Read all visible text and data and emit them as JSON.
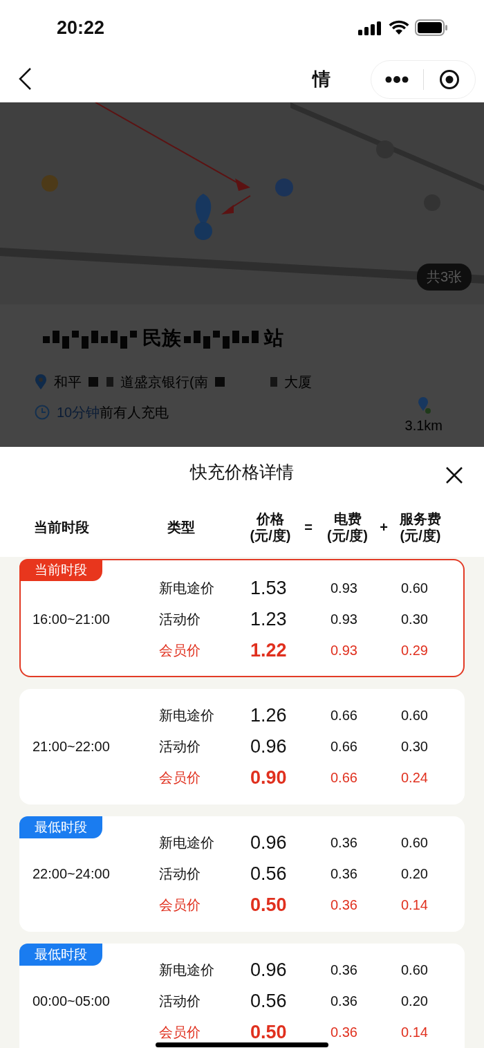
{
  "status_bar": {
    "time": "20:22"
  },
  "nav_bar": {
    "title": "情"
  },
  "map": {
    "kind": "picture",
    "photo_count": "共3张"
  },
  "station": {
    "name_parts": [
      "民族",
      "站"
    ],
    "address_parts": [
      "和平",
      "道盛京银行(南",
      "大厦"
    ],
    "distance": "3.1km",
    "wait_highlight": "10分钟",
    "wait_text": "前有人充电"
  },
  "price_sheet": {
    "title": "快充价格详情",
    "columns": {
      "period": "当前时段",
      "type": "类型",
      "price": [
        "价格",
        "(元/度)"
      ],
      "equals": "=",
      "electricity": [
        "电费",
        "(元/度)"
      ],
      "plus": "+",
      "service": [
        "服务费",
        "(元/度)"
      ]
    },
    "periods": [
      {
        "time": "16:00~21:00",
        "highlighted": true,
        "badge": {
          "text": "当前时段",
          "kind": "current"
        },
        "rows": [
          {
            "type": "新电途价",
            "kind": "regular",
            "price": "1.53",
            "electricity": "0.93",
            "service": "0.60"
          },
          {
            "type": "活动价",
            "kind": "regular",
            "price": "1.23",
            "electricity": "0.93",
            "service": "0.30"
          },
          {
            "type": "会员价",
            "kind": "member",
            "price": "1.22",
            "electricity": "0.93",
            "service": "0.29"
          }
        ]
      },
      {
        "time": "21:00~22:00",
        "highlighted": false,
        "rows": [
          {
            "type": "新电途价",
            "kind": "regular",
            "price": "1.26",
            "electricity": "0.66",
            "service": "0.60"
          },
          {
            "type": "活动价",
            "kind": "regular",
            "price": "0.96",
            "electricity": "0.66",
            "service": "0.30"
          },
          {
            "type": "会员价",
            "kind": "member",
            "price": "0.90",
            "electricity": "0.66",
            "service": "0.24"
          }
        ]
      },
      {
        "time": "22:00~24:00",
        "highlighted": false,
        "badge": {
          "text": "最低时段",
          "kind": "lowest"
        },
        "rows": [
          {
            "type": "新电途价",
            "kind": "regular",
            "price": "0.96",
            "electricity": "0.36",
            "service": "0.60"
          },
          {
            "type": "活动价",
            "kind": "regular",
            "price": "0.56",
            "electricity": "0.36",
            "service": "0.20"
          },
          {
            "type": "会员价",
            "kind": "member",
            "price": "0.50",
            "electricity": "0.36",
            "service": "0.14"
          }
        ]
      },
      {
        "time": "00:00~05:00",
        "highlighted": false,
        "badge": {
          "text": "最低时段",
          "kind": "lowest"
        },
        "rows": [
          {
            "type": "新电途价",
            "kind": "regular",
            "price": "0.96",
            "electricity": "0.36",
            "service": "0.60"
          },
          {
            "type": "活动价",
            "kind": "regular",
            "price": "0.56",
            "electricity": "0.36",
            "service": "0.20"
          },
          {
            "type": "会员价",
            "kind": "member",
            "price": "0.50",
            "electricity": "0.36",
            "service": "0.14"
          }
        ]
      }
    ]
  }
}
